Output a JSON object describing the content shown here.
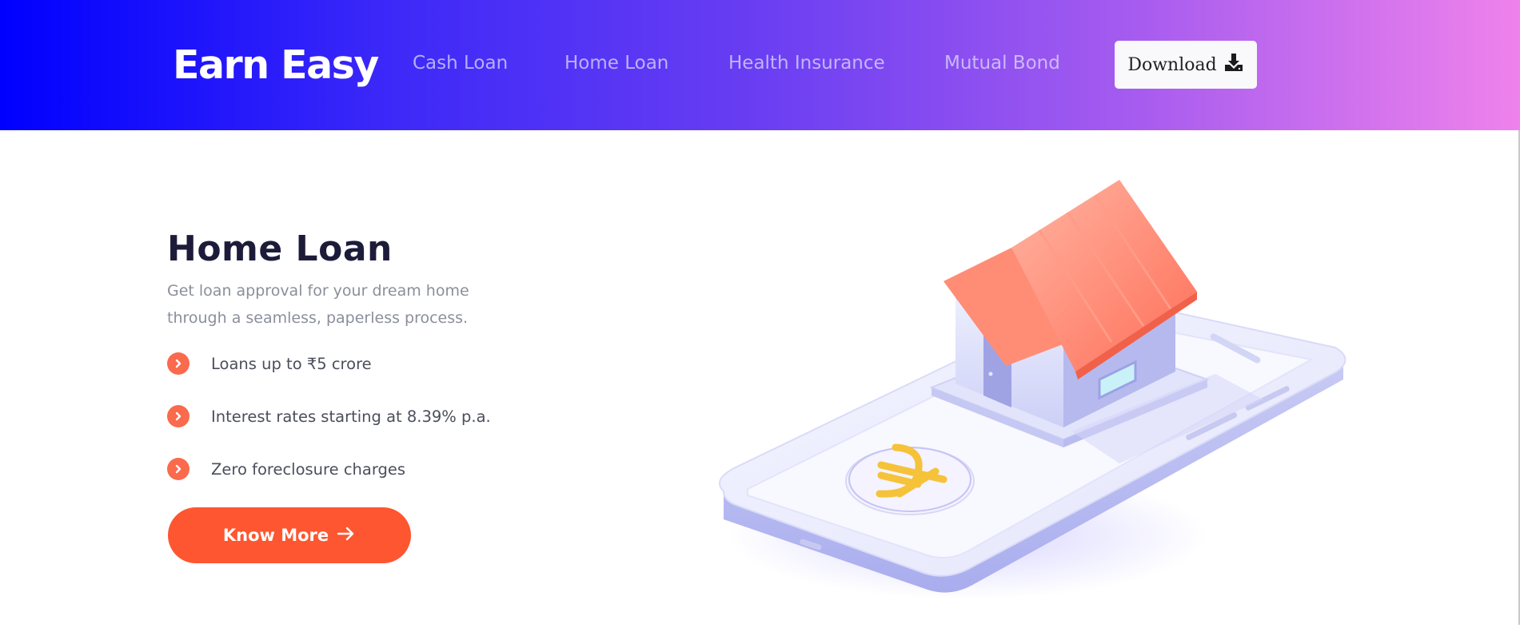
{
  "header": {
    "brand": "Earn Easy",
    "nav": [
      {
        "label": "Cash Loan"
      },
      {
        "label": "Home Loan"
      },
      {
        "label": "Health Insurance"
      },
      {
        "label": "Mutual Bond"
      }
    ],
    "download_label": "Download",
    "download_icon": "download-icon"
  },
  "hero": {
    "title": "Home Loan",
    "subtitle": "Get loan approval for your dream home through a seamless, paperless process.",
    "features": [
      {
        "text": "Loans up to ₹5 crore"
      },
      {
        "text": "Interest rates starting at 8.39% p.a."
      },
      {
        "text": "Zero foreclosure charges"
      }
    ],
    "cta_label": "Know More",
    "cta_icon": "arrow-right-icon"
  },
  "illustration": {
    "name": "house-on-phone-illustration",
    "symbol": "₹"
  },
  "colors": {
    "header_gradient_start": "#0000ff",
    "header_gradient_end": "#ef82ec",
    "accent": "#fe5630",
    "bullet": "#fa6a4c",
    "title": "#1c1c3a",
    "roof": "#ff7a63",
    "coin": "#f5c23a"
  }
}
